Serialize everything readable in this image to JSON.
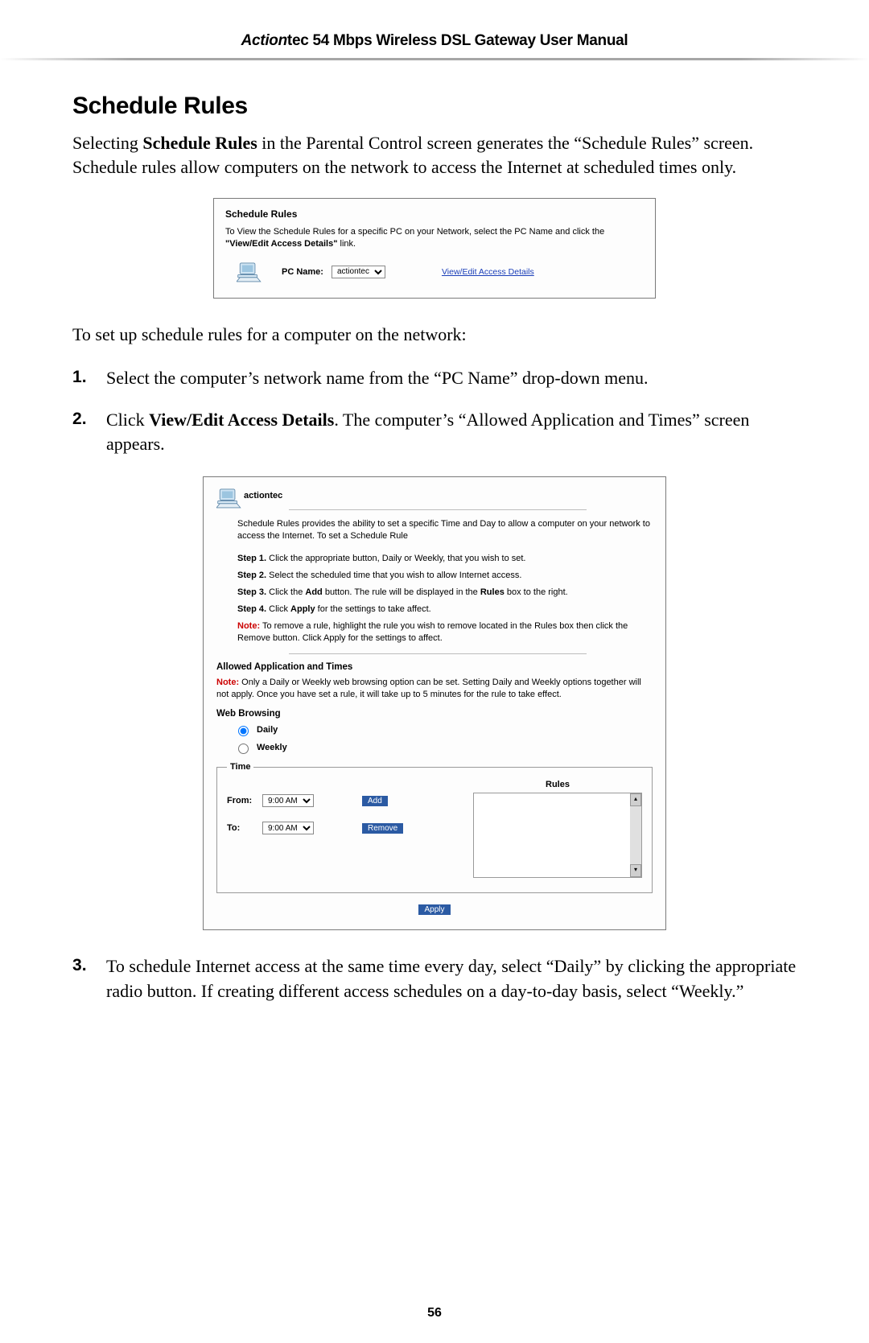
{
  "header": {
    "brand_prefix": "Action",
    "title_rest": "tec 54 Mbps Wireless DSL Gateway User Manual"
  },
  "section_heading": "Schedule Rules",
  "intro": {
    "pre": "Selecting ",
    "bold": "Schedule Rules",
    "post": " in the Parental Control screen generates the “Schedule Rules” screen. Schedule rules allow computers on the network to access the Internet at scheduled times only."
  },
  "screenshot1": {
    "title": "Schedule Rules",
    "desc_pre": "To View the Schedule Rules for a specific PC on your Network, select the PC Name and click the ",
    "desc_bold": "\"View/Edit Access Details\"",
    "desc_post": " link.",
    "pcname_label": "PC Name:",
    "pcname_value": "actiontec",
    "link": "View/Edit Access Details"
  },
  "lead_in": "To set up schedule rules for a computer on the network:",
  "step1": "Select the computer’s network name from the “PC Name” drop-down menu.",
  "step2": {
    "pre": "Click ",
    "bold": "View/Edit Access Details",
    "post": ". The computer’s “Allowed Application and Times” screen appears."
  },
  "screenshot2": {
    "pc_name": "actiontec",
    "intro": "Schedule Rules provides the ability to set a specific Time and Day to allow a computer on your network to access the Internet. To set a Schedule Rule",
    "s1_pre": "Step 1.",
    "s1_txt": " Click the appropriate button, Daily or Weekly, that you wish to set.",
    "s2_pre": "Step 2.",
    "s2_txt": " Select the scheduled time that you wish to allow Internet access.",
    "s3_pre": "Step 3.",
    "s3_txt_a": " Click the ",
    "s3_bold": "Add",
    "s3_txt_b": " button. The rule will be displayed in the ",
    "s3_bold2": "Rules",
    "s3_txt_c": " box to the right.",
    "s4_pre": "Step 4.",
    "s4_txt_a": " Click ",
    "s4_bold": "Apply",
    "s4_txt_b": " for the settings to take affect.",
    "note1_label": "Note:",
    "note1_txt": " To remove a rule, highlight the rule you wish to remove located in the Rules box then click the Remove button. Click Apply for the settings to affect.",
    "allowed_heading": "Allowed Application and Times",
    "note2_label": "Note:",
    "note2_txt": " Only a Daily or Weekly web browsing option can be set. Setting Daily and Weekly options together will not apply. Once you have set a rule, it will take up to 5 minutes for the rule to take effect.",
    "web_browsing": "Web Browsing",
    "radio_daily": "Daily",
    "radio_weekly": "Weekly",
    "time_legend": "Time",
    "from_label": "From:",
    "to_label": "To:",
    "from_value": "9:00 AM",
    "to_value": "9:00 AM",
    "add_btn": "Add",
    "remove_btn": "Remove",
    "rules_label": "Rules",
    "apply_btn": "Apply"
  },
  "step3": "To schedule Internet access at the same time every day, select “Daily” by clicking the appropriate radio button. If creating different access schedules on a day-to-day basis, select “Weekly.”",
  "page_number": "56"
}
